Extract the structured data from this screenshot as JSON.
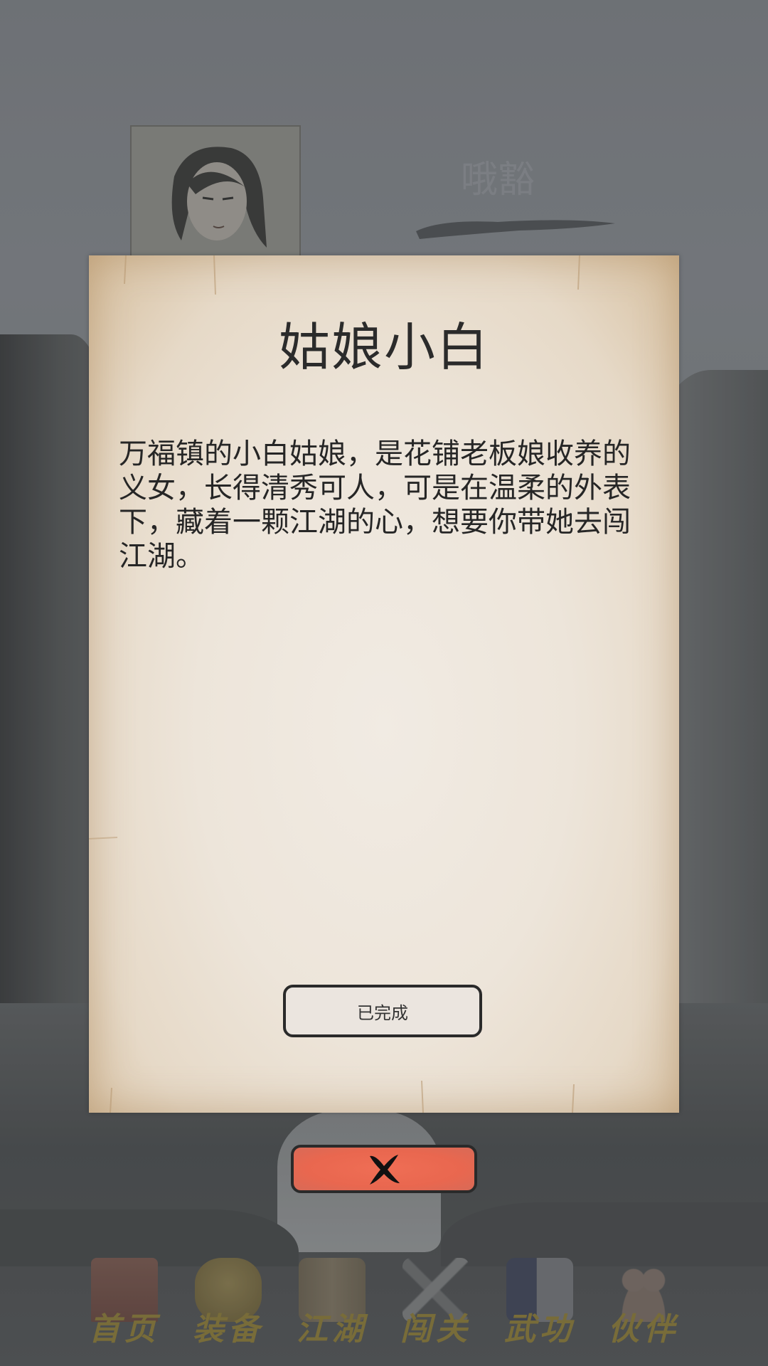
{
  "background": {
    "character_name": "哦豁"
  },
  "dialog": {
    "title": "姑娘小白",
    "description": "万福镇的小白姑娘，是花铺老板娘收养的义女，长得清秀可人，可是在温柔的外表下，藏着一颗江湖的心，想要你带她去闯江湖。",
    "status_button_label": "已完成"
  },
  "close_button": {
    "icon": "close-x-icon",
    "color": "#ea6a51"
  },
  "bottom_nav": {
    "items": [
      {
        "label": "首页",
        "icon": "home-gate-icon"
      },
      {
        "label": "装备",
        "icon": "armor-icon"
      },
      {
        "label": "江湖",
        "icon": "scroll-map-icon"
      },
      {
        "label": "闯关",
        "icon": "swords-icon"
      },
      {
        "label": "武功",
        "icon": "martial-book-icon"
      },
      {
        "label": "伙伴",
        "icon": "companions-icon"
      }
    ]
  },
  "colors": {
    "parchment": "#ede5da",
    "title_text": "#2b2b2b",
    "nav_label": "#8a7a3c",
    "close_button": "#ea6a51"
  }
}
